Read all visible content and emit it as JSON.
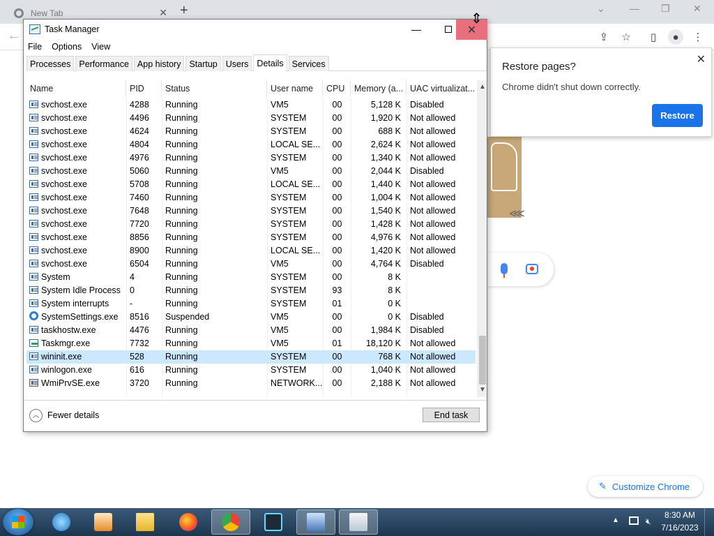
{
  "chrome": {
    "tab_title": "New Tab",
    "restore_popup": {
      "title": "Restore pages?",
      "message": "Chrome didn't shut down correctly.",
      "button": "Restore"
    },
    "customize_label": "Customize Chrome"
  },
  "task_manager": {
    "title": "Task Manager",
    "menu": [
      "File",
      "Options",
      "View"
    ],
    "tabs": [
      "Processes",
      "Performance",
      "App history",
      "Startup",
      "Users",
      "Details",
      "Services"
    ],
    "active_tab": "Details",
    "columns": {
      "name": "Name",
      "pid": "PID",
      "status": "Status",
      "user": "User name",
      "cpu": "CPU",
      "memory": "Memory (a...",
      "uac": "UAC virtualizat..."
    },
    "rows": [
      {
        "name": "svchost.exe",
        "pid": "4288",
        "status": "Running",
        "user": "VM5",
        "cpu": "00",
        "memory": "5,128 K",
        "uac": "Disabled",
        "icon": "process-icon"
      },
      {
        "name": "svchost.exe",
        "pid": "4496",
        "status": "Running",
        "user": "SYSTEM",
        "cpu": "00",
        "memory": "1,920 K",
        "uac": "Not allowed",
        "icon": "process-icon"
      },
      {
        "name": "svchost.exe",
        "pid": "4624",
        "status": "Running",
        "user": "SYSTEM",
        "cpu": "00",
        "memory": "688 K",
        "uac": "Not allowed",
        "icon": "process-icon"
      },
      {
        "name": "svchost.exe",
        "pid": "4804",
        "status": "Running",
        "user": "LOCAL SE...",
        "cpu": "00",
        "memory": "2,624 K",
        "uac": "Not allowed",
        "icon": "process-icon"
      },
      {
        "name": "svchost.exe",
        "pid": "4976",
        "status": "Running",
        "user": "SYSTEM",
        "cpu": "00",
        "memory": "1,340 K",
        "uac": "Not allowed",
        "icon": "process-icon"
      },
      {
        "name": "svchost.exe",
        "pid": "5060",
        "status": "Running",
        "user": "VM5",
        "cpu": "00",
        "memory": "2,044 K",
        "uac": "Disabled",
        "icon": "process-icon"
      },
      {
        "name": "svchost.exe",
        "pid": "5708",
        "status": "Running",
        "user": "LOCAL SE...",
        "cpu": "00",
        "memory": "1,440 K",
        "uac": "Not allowed",
        "icon": "process-icon"
      },
      {
        "name": "svchost.exe",
        "pid": "7460",
        "status": "Running",
        "user": "SYSTEM",
        "cpu": "00",
        "memory": "1,004 K",
        "uac": "Not allowed",
        "icon": "process-icon"
      },
      {
        "name": "svchost.exe",
        "pid": "7648",
        "status": "Running",
        "user": "SYSTEM",
        "cpu": "00",
        "memory": "1,540 K",
        "uac": "Not allowed",
        "icon": "process-icon"
      },
      {
        "name": "svchost.exe",
        "pid": "7720",
        "status": "Running",
        "user": "SYSTEM",
        "cpu": "00",
        "memory": "1,428 K",
        "uac": "Not allowed",
        "icon": "process-icon"
      },
      {
        "name": "svchost.exe",
        "pid": "8856",
        "status": "Running",
        "user": "SYSTEM",
        "cpu": "00",
        "memory": "4,976 K",
        "uac": "Not allowed",
        "icon": "process-icon"
      },
      {
        "name": "svchost.exe",
        "pid": "8900",
        "status": "Running",
        "user": "LOCAL SE...",
        "cpu": "00",
        "memory": "1,420 K",
        "uac": "Not allowed",
        "icon": "process-icon"
      },
      {
        "name": "svchost.exe",
        "pid": "6504",
        "status": "Running",
        "user": "VM5",
        "cpu": "00",
        "memory": "4,764 K",
        "uac": "Disabled",
        "icon": "process-icon"
      },
      {
        "name": "System",
        "pid": "4",
        "status": "Running",
        "user": "SYSTEM",
        "cpu": "00",
        "memory": "8 K",
        "uac": "",
        "icon": "process-icon"
      },
      {
        "name": "System Idle Process",
        "pid": "0",
        "status": "Running",
        "user": "SYSTEM",
        "cpu": "93",
        "memory": "8 K",
        "uac": "",
        "icon": "process-icon"
      },
      {
        "name": "System interrupts",
        "pid": "-",
        "status": "Running",
        "user": "SYSTEM",
        "cpu": "01",
        "memory": "0 K",
        "uac": "",
        "icon": "process-icon"
      },
      {
        "name": "SystemSettings.exe",
        "pid": "8516",
        "status": "Suspended",
        "user": "VM5",
        "cpu": "00",
        "memory": "0 K",
        "uac": "Disabled",
        "icon": "gear-icon"
      },
      {
        "name": "taskhostw.exe",
        "pid": "4476",
        "status": "Running",
        "user": "VM5",
        "cpu": "00",
        "memory": "1,984 K",
        "uac": "Disabled",
        "icon": "process-icon"
      },
      {
        "name": "Taskmgr.exe",
        "pid": "7732",
        "status": "Running",
        "user": "VM5",
        "cpu": "01",
        "memory": "18,120 K",
        "uac": "Not allowed",
        "icon": "chart-icon"
      },
      {
        "name": "wininit.exe",
        "pid": "528",
        "status": "Running",
        "user": "SYSTEM",
        "cpu": "00",
        "memory": "768 K",
        "uac": "Not allowed",
        "icon": "process-icon",
        "selected": true
      },
      {
        "name": "winlogon.exe",
        "pid": "616",
        "status": "Running",
        "user": "SYSTEM",
        "cpu": "00",
        "memory": "1,040 K",
        "uac": "Not allowed",
        "icon": "process-icon"
      },
      {
        "name": "WmiPrvSE.exe",
        "pid": "3720",
        "status": "Running",
        "user": "NETWORK...",
        "cpu": "00",
        "memory": "2,188 K",
        "uac": "Not allowed",
        "icon": "wmi-icon"
      }
    ],
    "fewer_details": "Fewer details",
    "end_task": "End task"
  },
  "taskbar": {
    "time": "8:30 AM",
    "date": "7/16/2023"
  },
  "colors": {
    "close_button": "#e8707c",
    "selected_row": "#cce8ff",
    "restore_button": "#1a73e8",
    "taskbar": "#1d3650"
  }
}
